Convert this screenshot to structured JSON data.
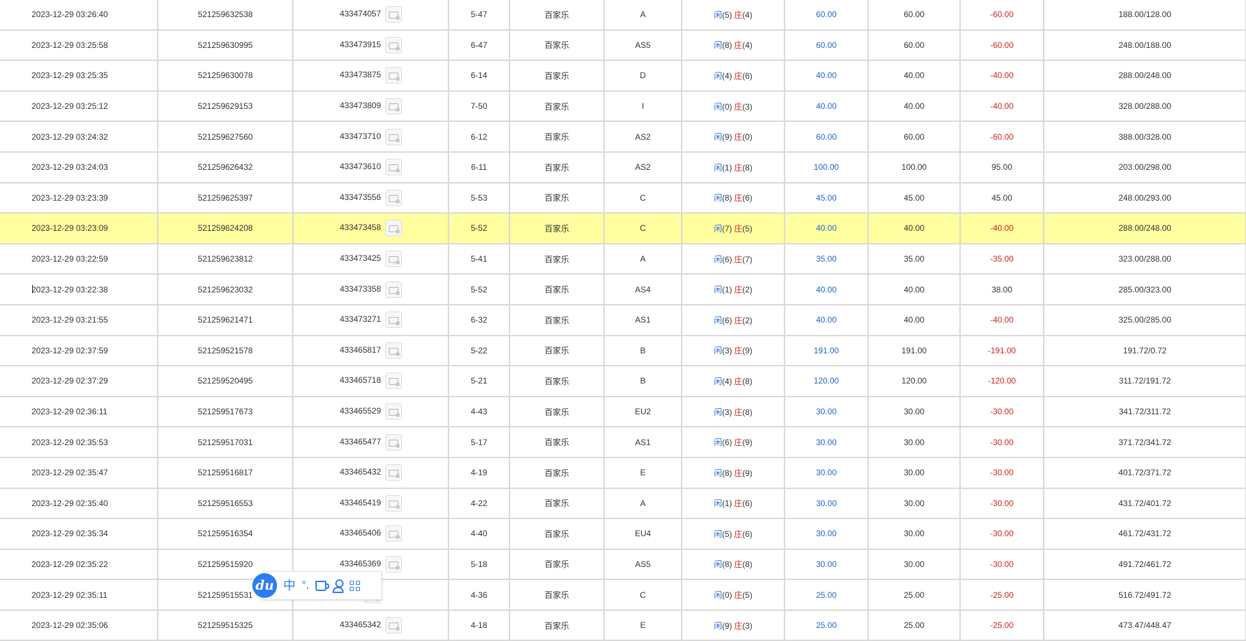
{
  "rows": [
    {
      "time": "2023-12-29 03:26:40",
      "order_id": "521259632538",
      "game_id": "433474057",
      "shoe": "5-47",
      "game": "百家乐",
      "table": "A",
      "xian_label": "闲",
      "xian": "(5)",
      "zhuang_label": "庄",
      "zhuang": "(4)",
      "bet": "60.00",
      "valid": "60.00",
      "payout": "-60.00",
      "payout_sign": "neg",
      "balance": "188.00/128.00"
    },
    {
      "time": "2023-12-29 03:25:58",
      "order_id": "521259630995",
      "game_id": "433473915",
      "shoe": "6-47",
      "game": "百家乐",
      "table": "AS5",
      "xian_label": "闲",
      "xian": "(8)",
      "zhuang_label": "庄",
      "zhuang": "(4)",
      "bet": "60.00",
      "valid": "60.00",
      "payout": "-60.00",
      "payout_sign": "neg",
      "balance": "248.00/188.00"
    },
    {
      "time": "2023-12-29 03:25:35",
      "order_id": "521259630078",
      "game_id": "433473875",
      "shoe": "6-14",
      "game": "百家乐",
      "table": "D",
      "xian_label": "闲",
      "xian": "(4)",
      "zhuang_label": "庄",
      "zhuang": "(6)",
      "bet": "40.00",
      "valid": "40.00",
      "payout": "-40.00",
      "payout_sign": "neg",
      "balance": "288.00/248.00"
    },
    {
      "time": "2023-12-29 03:25:12",
      "order_id": "521259629153",
      "game_id": "433473809",
      "shoe": "7-50",
      "game": "百家乐",
      "table": "I",
      "xian_label": "闲",
      "xian": "(0)",
      "zhuang_label": "庄",
      "zhuang": "(3)",
      "bet": "40.00",
      "valid": "40.00",
      "payout": "-40.00",
      "payout_sign": "neg",
      "balance": "328.00/288.00"
    },
    {
      "time": "2023-12-29 03:24:32",
      "order_id": "521259627560",
      "game_id": "433473710",
      "shoe": "6-12",
      "game": "百家乐",
      "table": "AS2",
      "xian_label": "闲",
      "xian": "(9)",
      "zhuang_label": "庄",
      "zhuang": "(0)",
      "bet": "60.00",
      "valid": "60.00",
      "payout": "-60.00",
      "payout_sign": "neg",
      "balance": "388.00/328.00"
    },
    {
      "time": "2023-12-29 03:24:03",
      "order_id": "521259626432",
      "game_id": "433473610",
      "shoe": "6-11",
      "game": "百家乐",
      "table": "AS2",
      "xian_label": "闲",
      "xian": "(1)",
      "zhuang_label": "庄",
      "zhuang": "(8)",
      "bet": "100.00",
      "valid": "100.00",
      "payout": "95.00",
      "payout_sign": "pos",
      "balance": "203.00/298.00"
    },
    {
      "time": "2023-12-29 03:23:39",
      "order_id": "521259625397",
      "game_id": "433473556",
      "shoe": "5-53",
      "game": "百家乐",
      "table": "C",
      "xian_label": "闲",
      "xian": "(8)",
      "zhuang_label": "庄",
      "zhuang": "(6)",
      "bet": "45.00",
      "valid": "45.00",
      "payout": "45.00",
      "payout_sign": "pos",
      "balance": "248.00/293.00"
    },
    {
      "time": "2023-12-29 03:23:09",
      "order_id": "521259624208",
      "game_id": "433473458",
      "shoe": "5-52",
      "game": "百家乐",
      "table": "C",
      "xian_label": "闲",
      "xian": "(7)",
      "zhuang_label": "庄",
      "zhuang": "(5)",
      "bet": "40.00",
      "valid": "40.00",
      "payout": "-40.00",
      "payout_sign": "neg",
      "balance": "288.00/248.00",
      "highlight": true
    },
    {
      "time": "2023-12-29 03:22:59",
      "order_id": "521259623812",
      "game_id": "433473425",
      "shoe": "5-41",
      "game": "百家乐",
      "table": "A",
      "xian_label": "闲",
      "xian": "(6)",
      "zhuang_label": "庄",
      "zhuang": "(7)",
      "bet": "35.00",
      "valid": "35.00",
      "payout": "-35.00",
      "payout_sign": "neg",
      "balance": "323.00/288.00"
    },
    {
      "time": "2023-12-29 03:22:38",
      "order_id": "521259623032",
      "game_id": "433473358",
      "shoe": "5-52",
      "game": "百家乐",
      "table": "AS4",
      "xian_label": "闲",
      "xian": "(1)",
      "zhuang_label": "庄",
      "zhuang": "(2)",
      "bet": "40.00",
      "valid": "40.00",
      "payout": "38.00",
      "payout_sign": "pos",
      "balance": "285.00/323.00",
      "caret": true
    },
    {
      "time": "2023-12-29 03:21:55",
      "order_id": "521259621471",
      "game_id": "433473271",
      "shoe": "6-32",
      "game": "百家乐",
      "table": "AS1",
      "xian_label": "闲",
      "xian": "(6)",
      "zhuang_label": "庄",
      "zhuang": "(2)",
      "bet": "40.00",
      "valid": "40.00",
      "payout": "-40.00",
      "payout_sign": "neg",
      "balance": "325.00/285.00"
    },
    {
      "time": "2023-12-29 02:37:59",
      "order_id": "521259521578",
      "game_id": "433465817",
      "shoe": "5-22",
      "game": "百家乐",
      "table": "B",
      "xian_label": "闲",
      "xian": "(3)",
      "zhuang_label": "庄",
      "zhuang": "(9)",
      "bet": "191.00",
      "valid": "191.00",
      "payout": "-191.00",
      "payout_sign": "neg",
      "balance": "191.72/0.72"
    },
    {
      "time": "2023-12-29 02:37:29",
      "order_id": "521259520495",
      "game_id": "433465718",
      "shoe": "5-21",
      "game": "百家乐",
      "table": "B",
      "xian_label": "闲",
      "xian": "(4)",
      "zhuang_label": "庄",
      "zhuang": "(8)",
      "bet": "120.00",
      "valid": "120.00",
      "payout": "-120.00",
      "payout_sign": "neg",
      "balance": "311.72/191.72"
    },
    {
      "time": "2023-12-29 02:36:11",
      "order_id": "521259517673",
      "game_id": "433465529",
      "shoe": "4-43",
      "game": "百家乐",
      "table": "EU2",
      "xian_label": "闲",
      "xian": "(3)",
      "zhuang_label": "庄",
      "zhuang": "(8)",
      "bet": "30.00",
      "valid": "30.00",
      "payout": "-30.00",
      "payout_sign": "neg",
      "balance": "341.72/311.72"
    },
    {
      "time": "2023-12-29 02:35:53",
      "order_id": "521259517031",
      "game_id": "433465477",
      "shoe": "5-17",
      "game": "百家乐",
      "table": "AS1",
      "xian_label": "闲",
      "xian": "(6)",
      "zhuang_label": "庄",
      "zhuang": "(9)",
      "bet": "30.00",
      "valid": "30.00",
      "payout": "-30.00",
      "payout_sign": "neg",
      "balance": "371.72/341.72"
    },
    {
      "time": "2023-12-29 02:35:47",
      "order_id": "521259516817",
      "game_id": "433465432",
      "shoe": "4-19",
      "game": "百家乐",
      "table": "E",
      "xian_label": "闲",
      "xian": "(8)",
      "zhuang_label": "庄",
      "zhuang": "(9)",
      "bet": "30.00",
      "valid": "30.00",
      "payout": "-30.00",
      "payout_sign": "neg",
      "balance": "401.72/371.72"
    },
    {
      "time": "2023-12-29 02:35:40",
      "order_id": "521259516553",
      "game_id": "433465419",
      "shoe": "4-22",
      "game": "百家乐",
      "table": "A",
      "xian_label": "闲",
      "xian": "(1)",
      "zhuang_label": "庄",
      "zhuang": "(6)",
      "bet": "30.00",
      "valid": "30.00",
      "payout": "-30.00",
      "payout_sign": "neg",
      "balance": "431.72/401.72"
    },
    {
      "time": "2023-12-29 02:35:34",
      "order_id": "521259516354",
      "game_id": "433465406",
      "shoe": "4-40",
      "game": "百家乐",
      "table": "EU4",
      "xian_label": "闲",
      "xian": "(5)",
      "zhuang_label": "庄",
      "zhuang": "(6)",
      "bet": "30.00",
      "valid": "30.00",
      "payout": "-30.00",
      "payout_sign": "neg",
      "balance": "461.72/431.72"
    },
    {
      "time": "2023-12-29 02:35:22",
      "order_id": "521259515920",
      "game_id": "433465369",
      "shoe": "5-18",
      "game": "百家乐",
      "table": "AS5",
      "xian_label": "闲",
      "xian": "(8)",
      "zhuang_label": "庄",
      "zhuang": "(8)",
      "bet": "30.00",
      "valid": "30.00",
      "payout": "-30.00",
      "payout_sign": "neg",
      "balance": "491.72/461.72"
    },
    {
      "time": "2023-12-29 02:35:11",
      "order_id": "521259515531",
      "game_id": "",
      "shoe": "4-36",
      "game": "百家乐",
      "table": "C",
      "xian_label": "闲",
      "xian": "(0)",
      "zhuang_label": "庄",
      "zhuang": "(5)",
      "bet": "25.00",
      "valid": "25.00",
      "payout": "-25.00",
      "payout_sign": "neg",
      "balance": "516.72/491.72"
    },
    {
      "time": "2023-12-29 02:35:06",
      "order_id": "521259515325",
      "game_id": "433465342",
      "shoe": "4-18",
      "game": "百家乐",
      "table": "E",
      "xian_label": "闲",
      "xian": "(9)",
      "zhuang_label": "庄",
      "zhuang": "(3)",
      "bet": "25.00",
      "valid": "25.00",
      "payout": "-25.00",
      "payout_sign": "neg",
      "balance": "473.47/448.47"
    }
  ],
  "colors": {
    "highlight_row": "#ffff9f",
    "grid_line": "#d9d9d9",
    "bet_blue": "#1f63cc",
    "loss_red": "#d42020",
    "player_blue": "#2b6bd6",
    "banker_red": "#d62b2b",
    "ime_blue": "#2b7cf5"
  },
  "ime_toolbar": {
    "logo_text": "du",
    "mode_label": "中",
    "punct_label": "°,",
    "icons": [
      "du-logo-icon",
      "skin-cup-icon",
      "user-icon",
      "grid-menu-icon"
    ]
  }
}
